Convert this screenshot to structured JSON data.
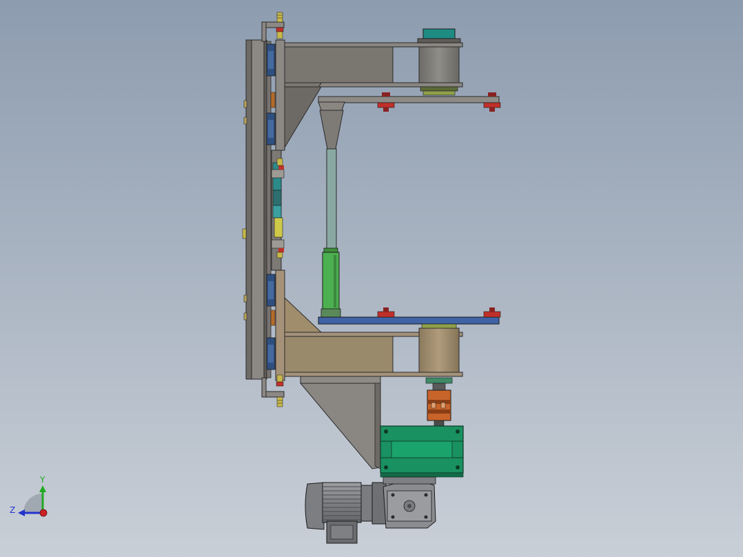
{
  "viewport": {
    "background_top": "#8d9caf",
    "background_bottom": "#c9cfd7"
  },
  "triad": {
    "y_label": "Y",
    "z_label": "Z",
    "y_color": "#22aa22",
    "z_color": "#2233cc",
    "x_color": "#cc2222"
  },
  "colors": {
    "frame_dark": "#7a7672",
    "frame_plate": "#8c8884",
    "arm_gray": "#7a7670",
    "arm_tan": "#9a8a6c",
    "roller_gray": "#7f7d78",
    "roller_tan": "#a08e70",
    "cap_teal": "#1f8c84",
    "plate_blue": "#3f63a5",
    "rod_green": "#4caf50",
    "rod_gray": "#8aa8a2",
    "gearbox_green": "#1a9160",
    "coupling_orange": "#c8642a",
    "motor_gray": "#8a8c90",
    "bolt_red": "#c0302a",
    "bolt_yellow": "#c8b84a",
    "bearing_blue": "#2f4f7f"
  }
}
